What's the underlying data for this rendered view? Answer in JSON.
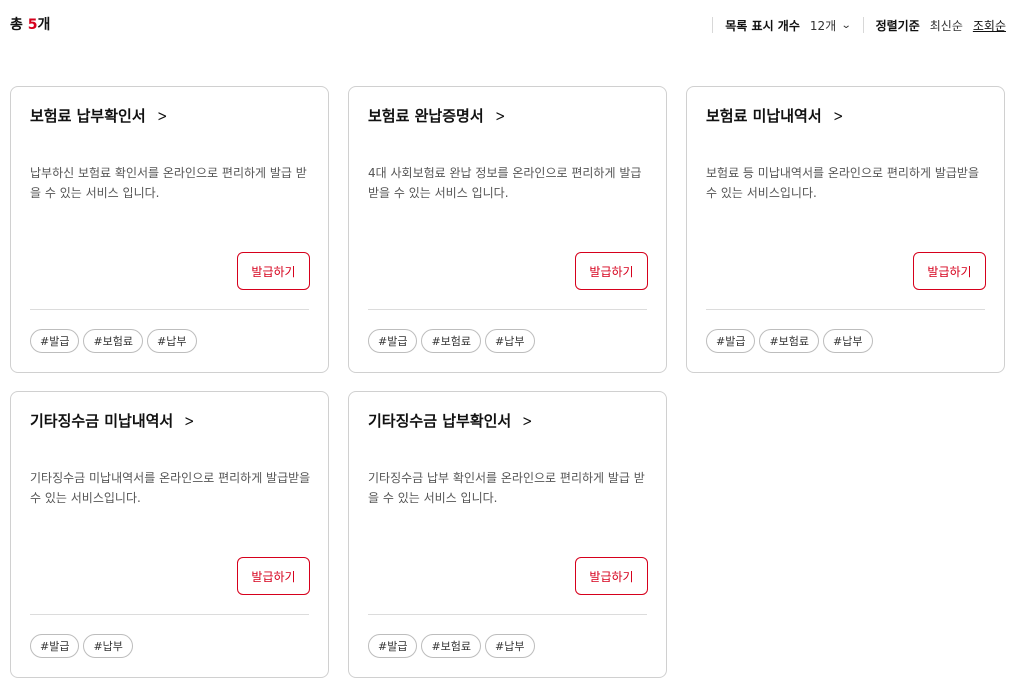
{
  "header": {
    "total_prefix": "총 ",
    "total_count": "5",
    "total_suffix": "개",
    "list_count_label": "목록 표시 개수",
    "list_count_value": "12개",
    "sort_label": "정렬기준",
    "sort_options": [
      "최신순",
      "조회순"
    ],
    "active_sort": "조회순"
  },
  "cards": [
    {
      "title": "보험료 납부확인서",
      "description": "납부하신 보험료 확인서를 온라인으로 편리하게 발급 받을 수 있는 서비스 입니다.",
      "button_label": "발급하기",
      "tags": [
        "#발급",
        "#보험료",
        "#납부"
      ]
    },
    {
      "title": "보험료 완납증명서",
      "description": "4대 사회보험료 완납 정보를 온라인으로 편리하게 발급받을 수 있는 서비스 입니다.",
      "button_label": "발급하기",
      "tags": [
        "#발급",
        "#보험료",
        "#납부"
      ]
    },
    {
      "title": "보험료 미납내역서",
      "description": "보험료 등 미납내역서를 온라인으로 편리하게 발급받을 수 있는 서비스입니다.",
      "button_label": "발급하기",
      "tags": [
        "#발급",
        "#보험료",
        "#납부"
      ]
    },
    {
      "title": "기타징수금 미납내역서",
      "description": "기타징수금 미납내역서를 온라인으로 편리하게 발급받을 수 있는 서비스입니다.",
      "button_label": "발급하기",
      "tags": [
        "#발급",
        "#납부"
      ]
    },
    {
      "title": "기타징수금 납부확인서",
      "description": "기타징수금 납부 확인서를 온라인으로 편리하게 발급 받을 수 있는 서비스 입니다.",
      "button_label": "발급하기",
      "tags": [
        "#발급",
        "#보험료",
        "#납부"
      ]
    }
  ],
  "icons": {
    "title_arrow": "chevron-right-icon",
    "dropdown": "chevron-down-icon"
  },
  "colors": {
    "accent": "#d6001c",
    "border": "#d0d0d0",
    "text": "#111111",
    "muted": "#555555"
  }
}
